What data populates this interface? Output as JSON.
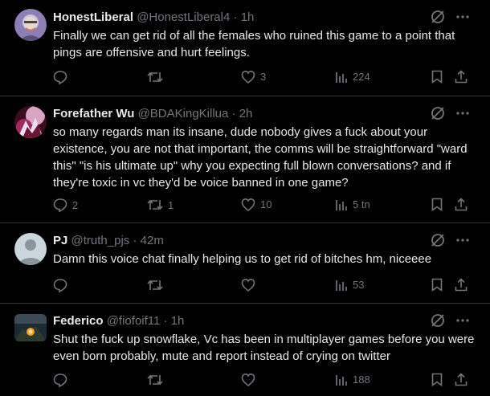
{
  "tweets": [
    {
      "name": "HonestLiberal",
      "handle": "@HonestLiberal4",
      "time": "1h",
      "text": "Finally we can get rid of all the females who ruined this game to a point that pings are offensive and hurt feelings.",
      "replies": "",
      "retweets": "",
      "likes": "3",
      "views": "224"
    },
    {
      "name": "Forefather Wu",
      "handle": "@BDAKingKillua",
      "time": "2h",
      "text": "so many regards man its insane, dude nobody gives a fuck about your existence, you are not that important, the comms will be straightforward \"ward this\" \"is his ultimate up\" why you expecting full blown conversations? and if they're toxic in vc they'd be voice banned in one game?",
      "replies": "2",
      "retweets": "1",
      "likes": "10",
      "views": "5 tn"
    },
    {
      "name": "PJ",
      "handle": "@truth_pjs",
      "time": "42m",
      "text": "Damn this voice chat finally helping us to get rid of bitches hm, niceeee",
      "replies": "",
      "retweets": "",
      "likes": "",
      "views": "53"
    },
    {
      "name": "Federico",
      "handle": "@fiofoif11",
      "time": "1h",
      "text": "Shut the fuck up snowflake, Vc has been in multiplayer games before you were even born probably, mute and report instead of crying on twitter",
      "replies": "",
      "retweets": "",
      "likes": "",
      "views": "188"
    }
  ],
  "separator": "·",
  "icons": {
    "grok": "grok-icon",
    "more": "more-icon",
    "reply": "reply-icon",
    "retweet": "retweet-icon",
    "like": "like-icon",
    "views": "views-icon",
    "bookmark": "bookmark-icon",
    "share": "share-icon"
  },
  "colors": {
    "background": "#000000",
    "text": "#e7e9ea",
    "muted": "#71767b",
    "divider": "#2f3336"
  }
}
